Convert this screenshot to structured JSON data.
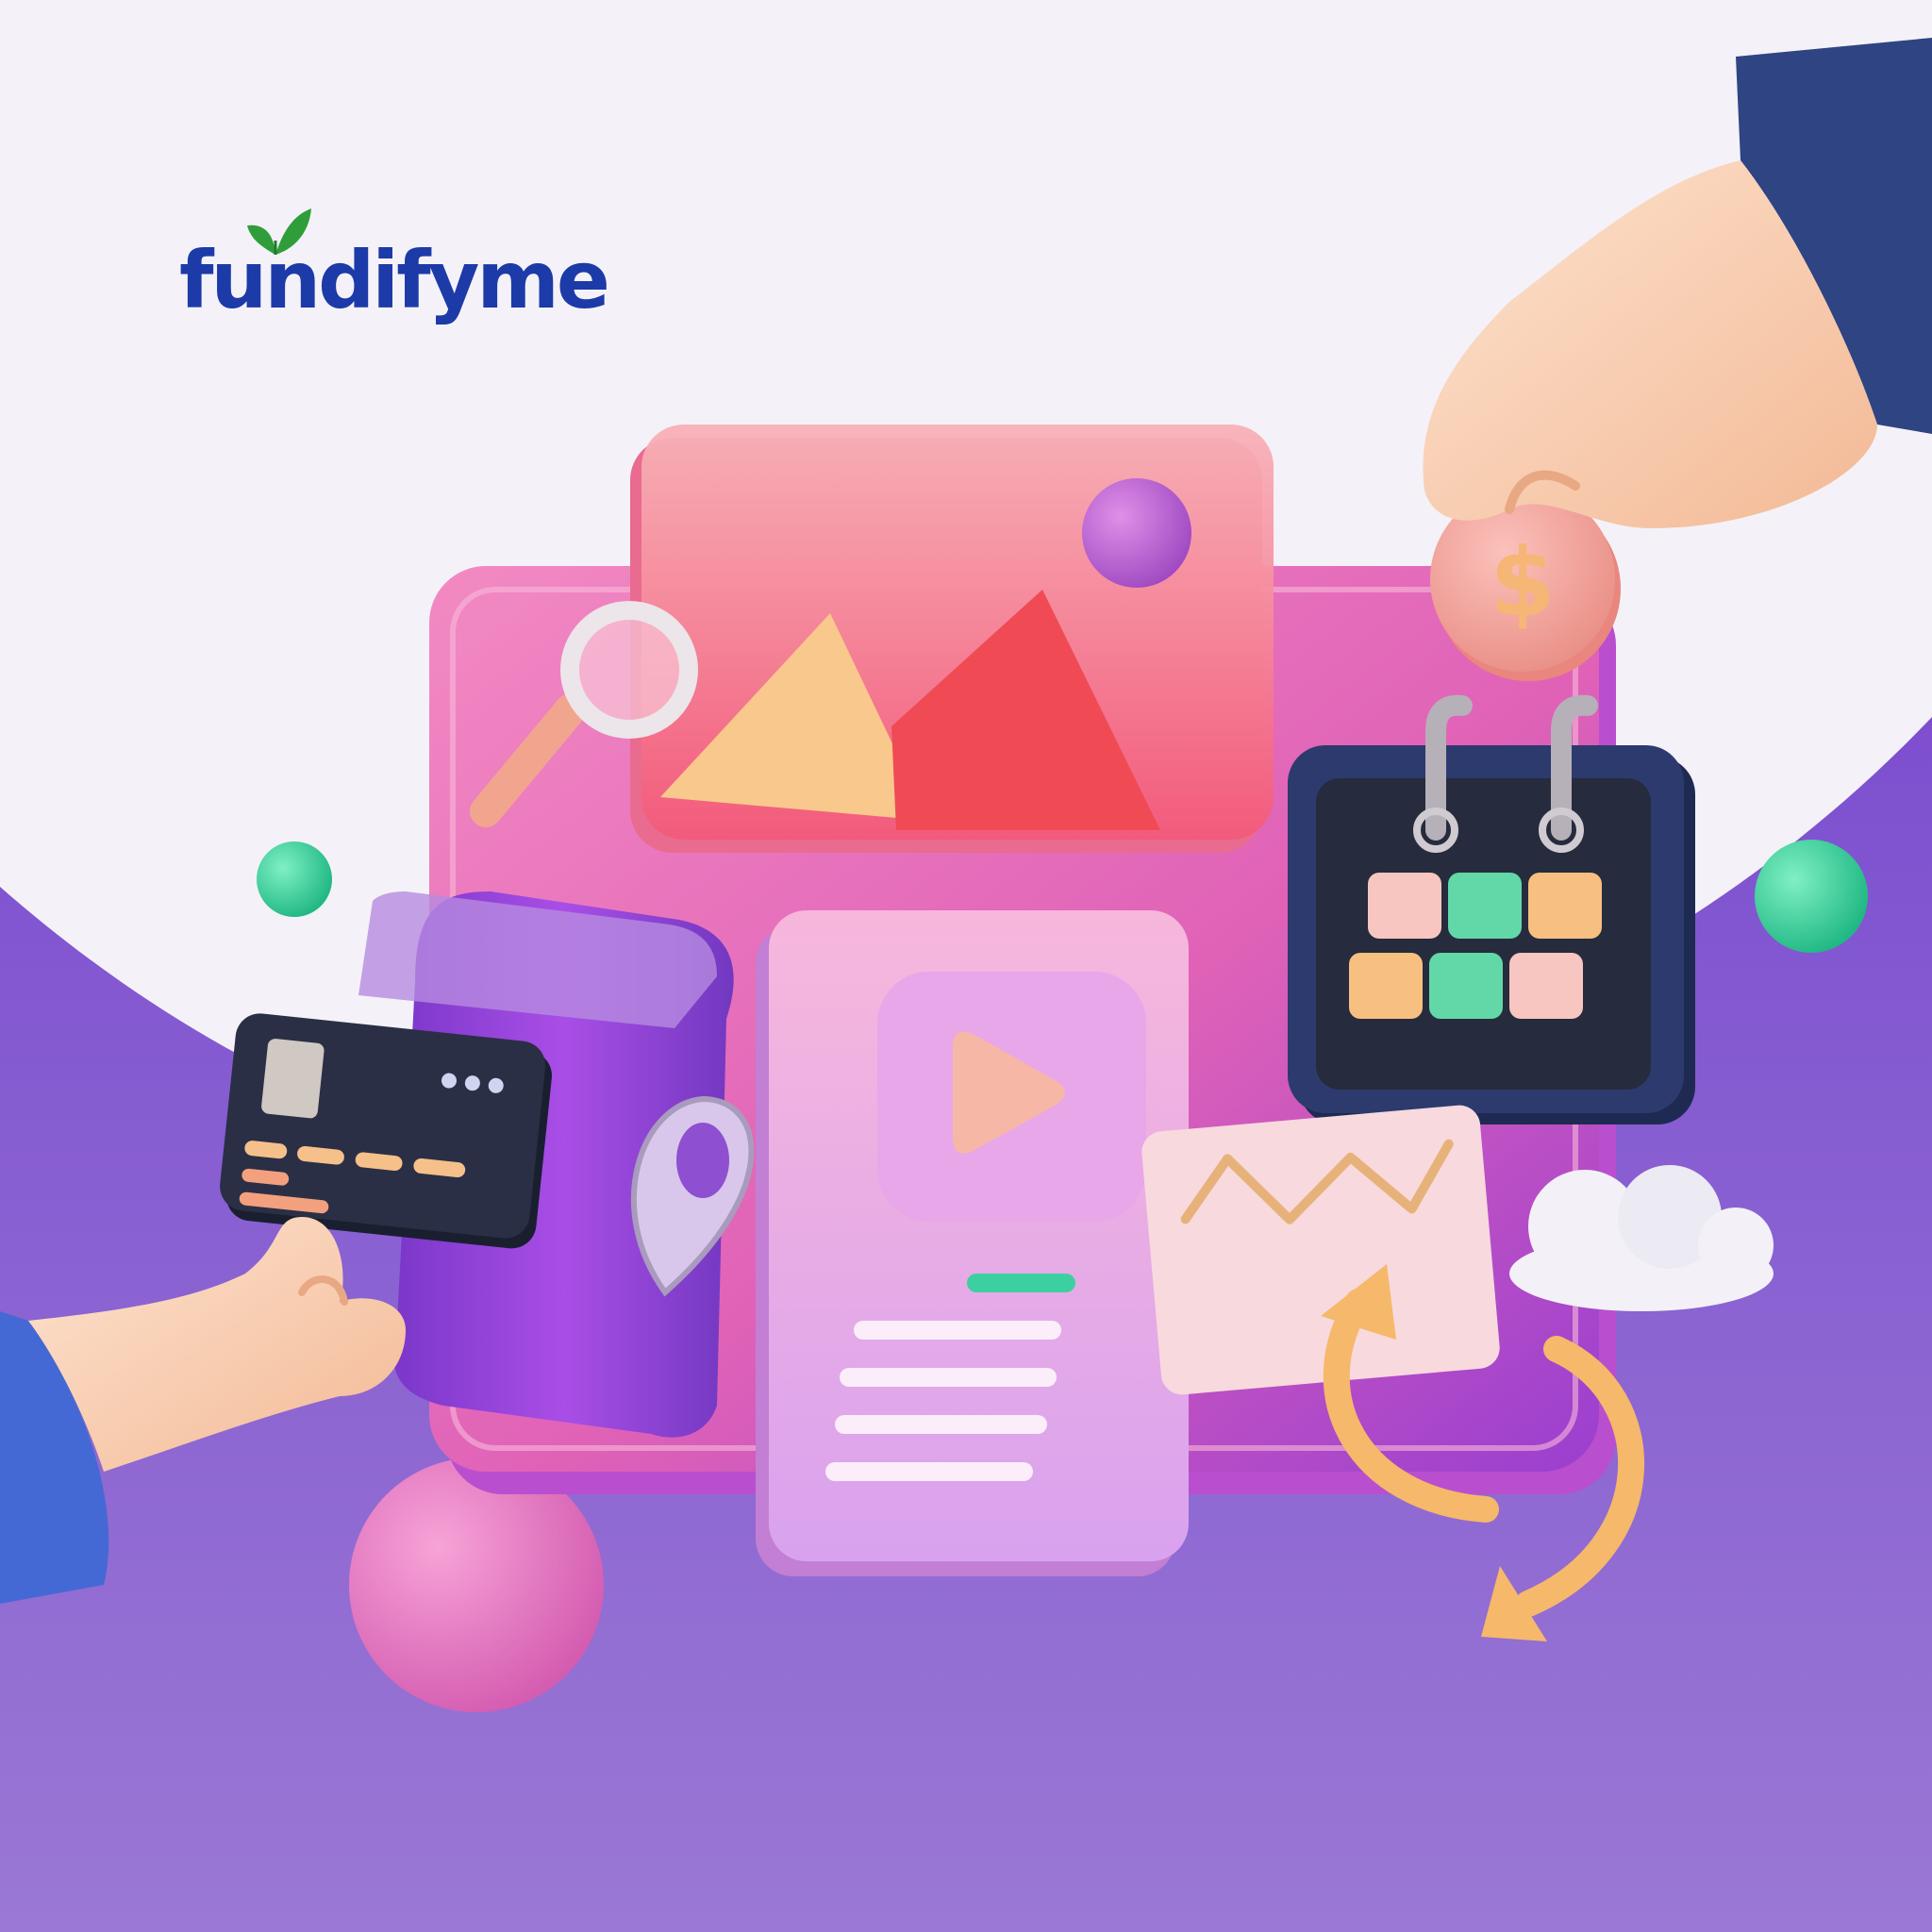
{
  "brand": {
    "name": "fundifyme",
    "logo_icon": "leaf-icon",
    "primary_color": "#1c3aa8",
    "leaf_color": "#2f9e3a"
  },
  "palette": {
    "background_top": "#f4f2f8",
    "background_wave": "#8b6bcf",
    "accent_pink": "#ec6aa8",
    "accent_green": "#3fd19a",
    "accent_orange": "#f4b562"
  },
  "illustration": {
    "icons": [
      "hand-holding-coin-icon",
      "dollar-coin-icon",
      "image-card-icon",
      "magnifier-icon",
      "calendar-icon",
      "video-play-icon",
      "line-chart-icon",
      "cloud-icon",
      "refresh-arrow-icon",
      "credit-card-icon",
      "hand-holding-card-icon",
      "location-pin-icon",
      "scroll-receipt-icon"
    ],
    "coin_symbol": "$"
  }
}
